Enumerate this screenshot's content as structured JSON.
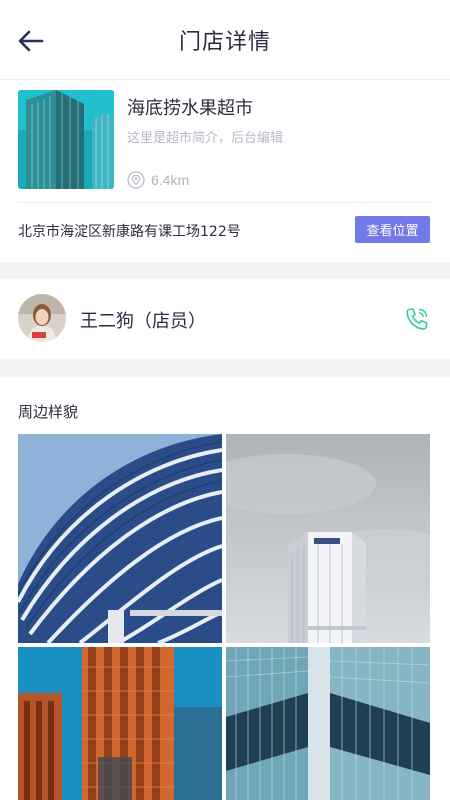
{
  "header": {
    "title": "门店详情",
    "back_icon": "arrow-left-icon"
  },
  "store": {
    "name": "海底捞水果超市",
    "description": "这里是超市简介，后台编辑",
    "distance": "6.4km",
    "address": "北京市海淀区新康路有课工场122号",
    "view_location_label": "查看位置",
    "accent_color": "#7479e8"
  },
  "staff": {
    "name": "王二狗（店员）",
    "phone_icon": "phone-icon",
    "phone_color": "#3ec9a7"
  },
  "surroundings": {
    "title": "周边样貌",
    "photos": [
      "curved-glass-building",
      "white-office-tower",
      "orange-highrises",
      "glass-skyscraper"
    ]
  }
}
